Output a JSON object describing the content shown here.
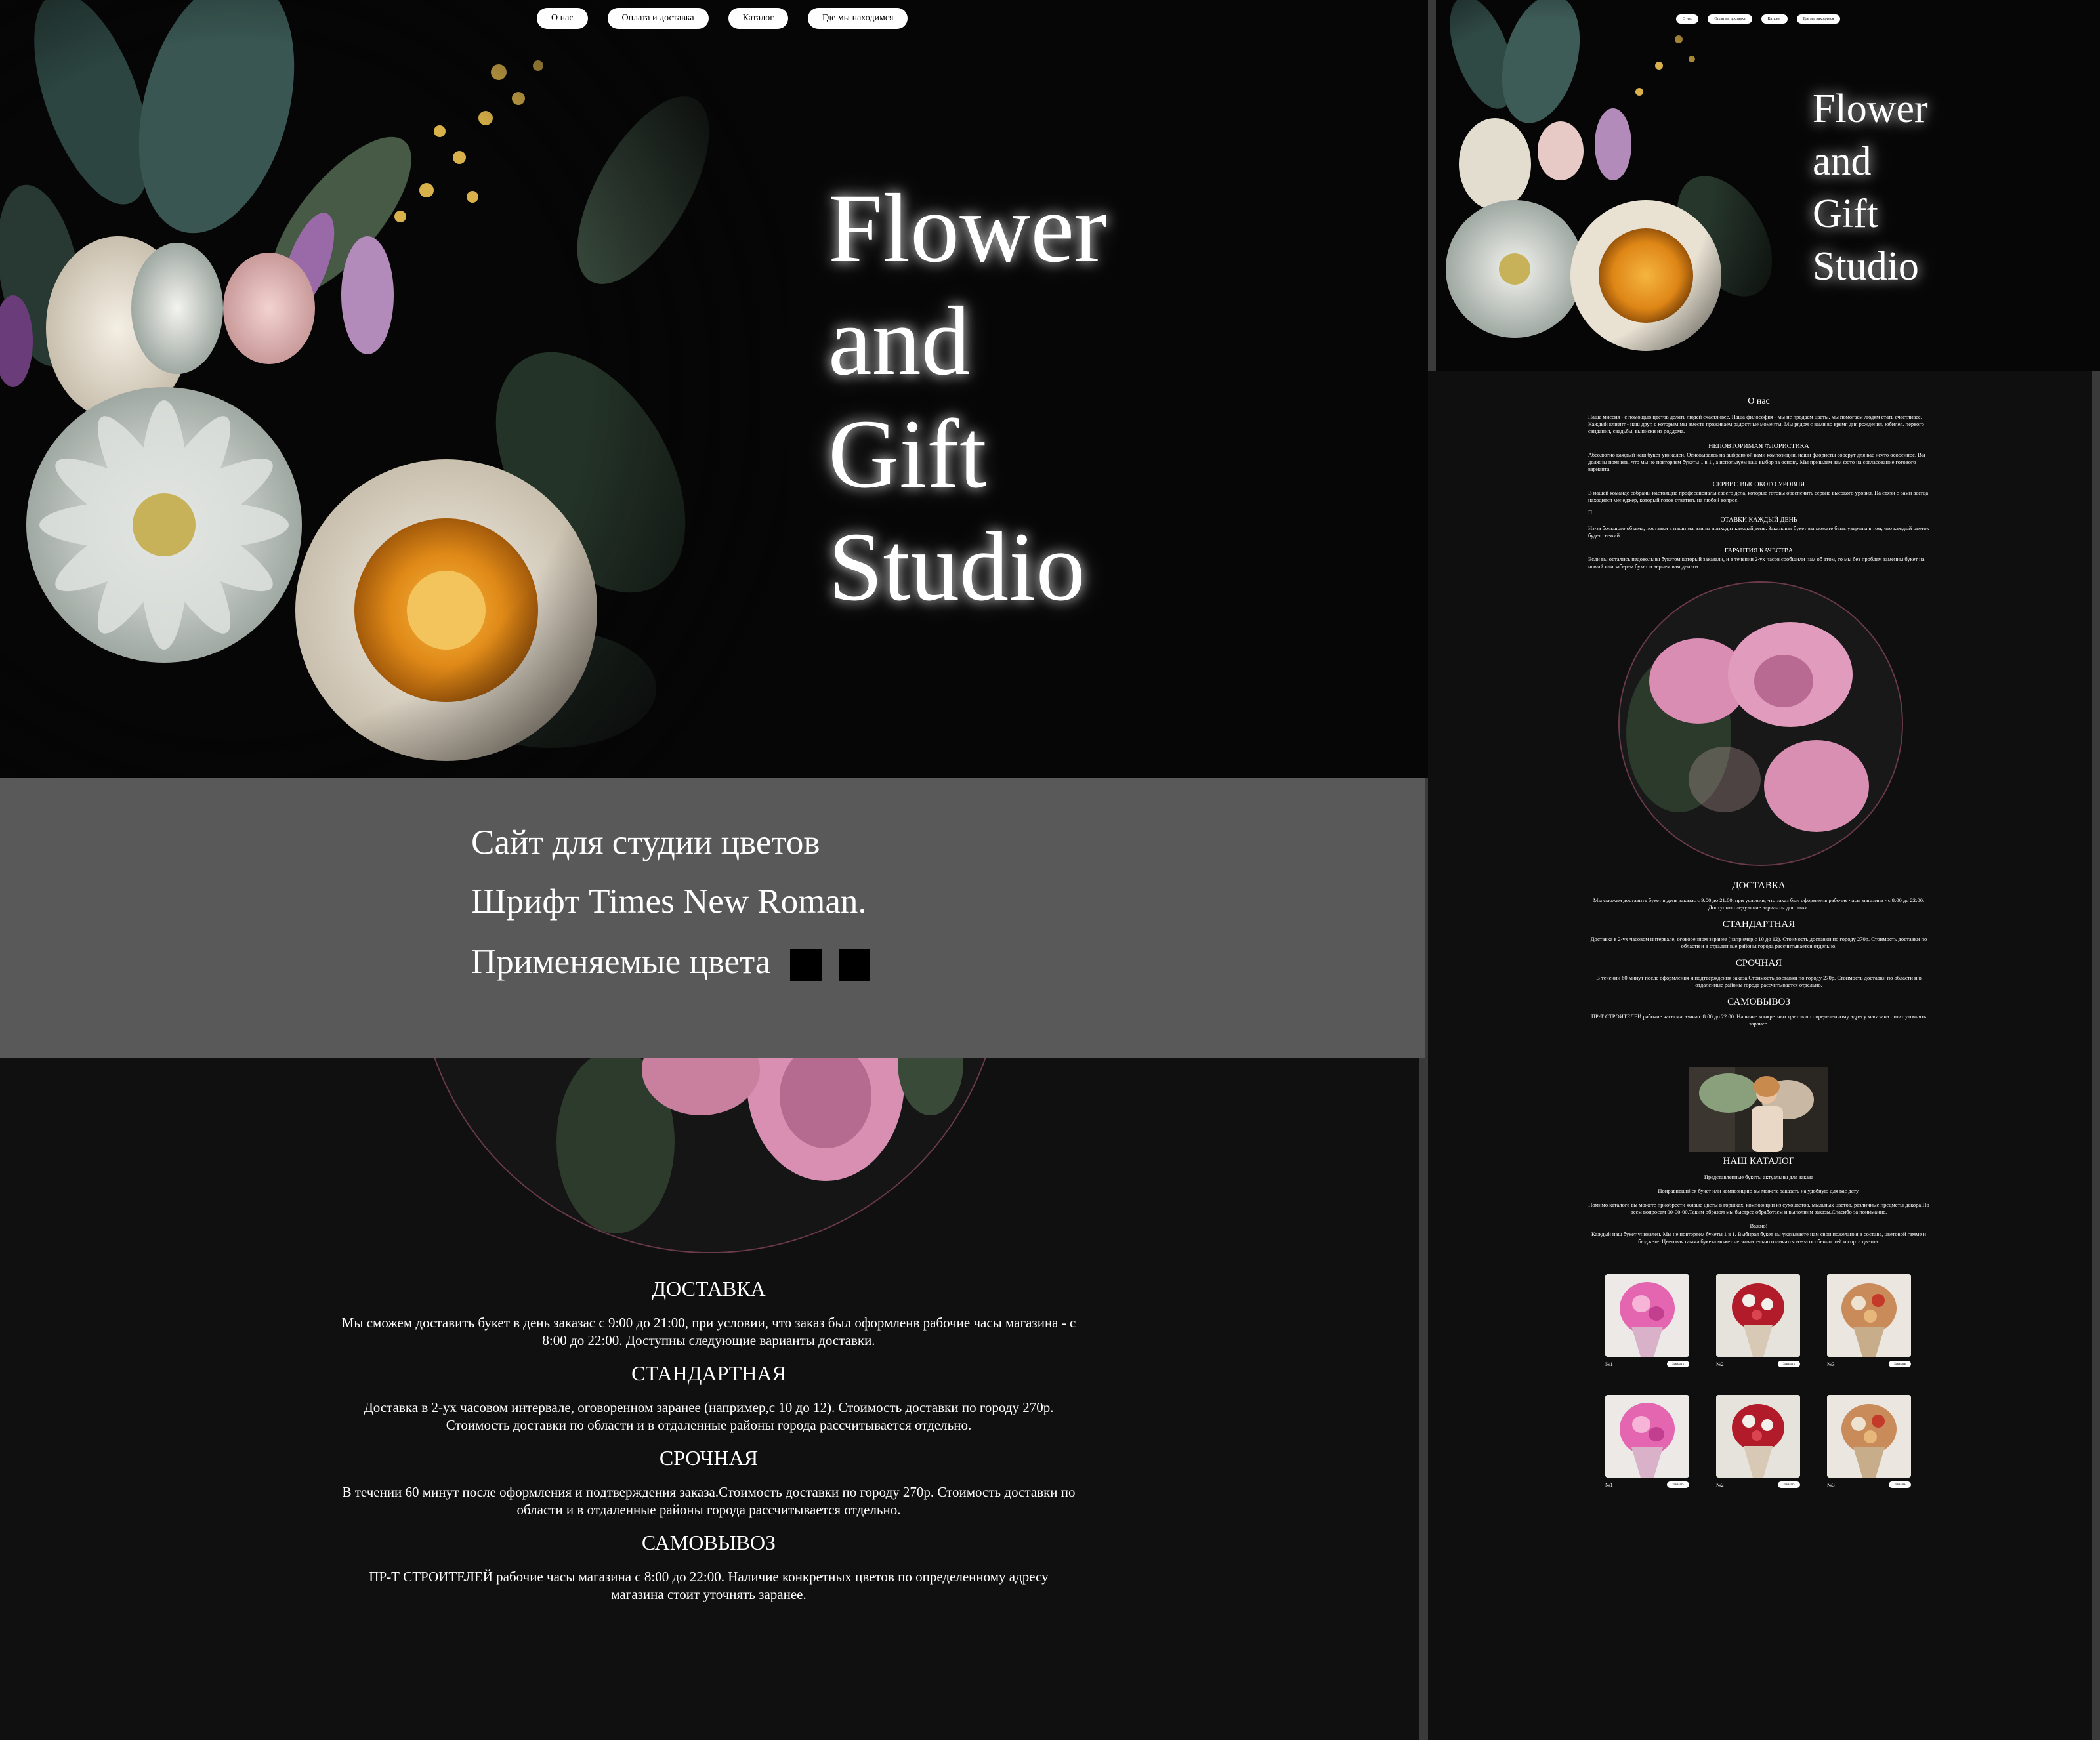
{
  "nav": [
    "О нас",
    "Оплата и доставка",
    "Каталог",
    "Где мы находимся"
  ],
  "hero": {
    "title_lines": [
      "Flower",
      "and",
      "Gift",
      "Studio"
    ]
  },
  "info_band": {
    "line1": "Сайт для  студии цветов",
    "line2": "Шрифт Times New Roman.",
    "line3": "Применяемые цвета",
    "colors": [
      "#000000",
      "#000000"
    ]
  },
  "about": {
    "title": "О нас",
    "intro": "Наша миссия - с помощью цветов делать людей счастливее. Наша философия - мы не продаем цветы, мы помогаем людям стать счастливее. Каждый клиент - наш друг, с которым мы вместе проживаем радостные моменты. Мы рядом с вами во время дня рождения, юбилея, первого свидания, свадьбы, выписки из роддома.",
    "blocks": [
      {
        "title": "НЕПОВТОРИМАЯ ФЛОРИСТИКА",
        "text": "Абсолютно каждый наш букет уникален. Основываясь на выбранной вами композиции, наши флористы соберут для вас нечто особенное. Вы должны помнить, что мы не повторяем букеты 1 в 1 , а используем ваш выбор за основу. Мы пришлем вам фото на согласование готового варианта."
      },
      {
        "title": "СЕРВИС ВЫСОКОГО УРОВНЯ",
        "text": "В нашей команде собраны настоящие профессионалы своего дела, которые готовы обеспечить сервис высокого уровня. На связи с вами всегда находится менеджер, который готов ответить на любой вопрос."
      },
      {
        "title": "ОТАВКИ КАЖДЫЙ ДЕНЬ",
        "text": "Из-за большого объема, поставки в наши магазины приходят каждый день. Заказывая букет вы можете быть уверены в том, что каждый цветок будет свежий."
      },
      {
        "title": "ГАРАНТИЯ КАЧЕСТВА",
        "text": "Если вы остались недовольны букетом который заказали, и в течении 2-ух часов сообщили нам об этом, то мы без проблем заменим букет на новый или заберем букет и вернем вам деньги."
      }
    ],
    "stray_letter": "П"
  },
  "delivery": {
    "title": "ДОСТАВКА",
    "intro": "Мы сможем доставить букет в день заказаc с 9:00 до 21:00, при условии, что заказ был оформленв рабочие часы магазина - с 8:00 до 22:00. Доступны следующие варианты доставки.",
    "standard_title": "СТАНДАРТНАЯ",
    "standard_text": "Доставка в 2-ух часовом интервале, оговоренном заранее (например,с 10 до 12). Стоимость доставки по городу 270р. Стоимость доставки по области и в отдаленные районы города рассчитывается отдельно.",
    "urgent_title": "СРОЧНАЯ",
    "urgent_text": "В течении 60 минут после оформления и подтверждения заказа.Стоимость доставки по городу 270р. Стоимость доставки по области и в отдаленные районы города рассчитывается отдельно.",
    "pickup_title": "САМОВЫВОЗ",
    "pickup_text": "ПР-Т СТРОИТЕЛЕЙ  рабочие часы магазина с 8:00 до 22:00. Наличие конкретных цветов по определенному адресу магазина стоит уточнять заранее."
  },
  "catalog": {
    "title": "НАШ КАТАЛОГ",
    "subtitle": "Представленные букеты актуальны для заказа",
    "p1": "Понравившийся букет или композицию вы можете заказать на удобную для вас дату.",
    "p2": "Помимо каталога вы можете приобрести живые цветы в горшках, композиции из сухоцветов, мыльных цветов, различные предметы декора.По всем вопросам 00-00-00.Таким образом мы быстрее обработаем и выполним заказы.Спасибо за понимание.",
    "p3": "Важно!",
    "p4": "Каждый наш букет уникален. Мы не повторяем букеты 1 в 1. Выбирая букет вы указываете нам свои пожелания в составе, цветовой гамме и бюджете. Цветовая гамма букета может не значительно отличатся из-за особенностей и сорта цветов.",
    "items": [
      {
        "num": "№1",
        "btn": "Заказать"
      },
      {
        "num": "№2",
        "btn": "Заказать"
      },
      {
        "num": "№3",
        "btn": "Заказать"
      },
      {
        "num": "№1",
        "btn": "Заказать"
      },
      {
        "num": "№2",
        "btn": "Заказать"
      },
      {
        "num": "№3",
        "btn": "Заказать"
      }
    ]
  }
}
